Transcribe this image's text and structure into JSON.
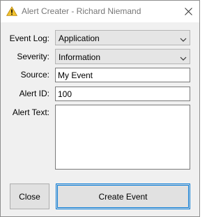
{
  "window": {
    "title": "Alert Creater - Richard Niemand",
    "title_icon": "warning-icon",
    "close_icon": "close-icon"
  },
  "form": {
    "event_log": {
      "label": "Event Log:",
      "value": "Application"
    },
    "severity": {
      "label": "Severity:",
      "value": "Information"
    },
    "source": {
      "label": "Source:",
      "value": "My Event"
    },
    "alert_id": {
      "label": "Alert ID:",
      "value": "100"
    },
    "alert_text": {
      "label": "Alert Text:",
      "value": ""
    }
  },
  "buttons": {
    "close_label": "Close",
    "create_label": "Create Event"
  },
  "colors": {
    "accent": "#0078d7",
    "warning_fill": "#f2c22e",
    "titlebar_text": "#777777"
  }
}
